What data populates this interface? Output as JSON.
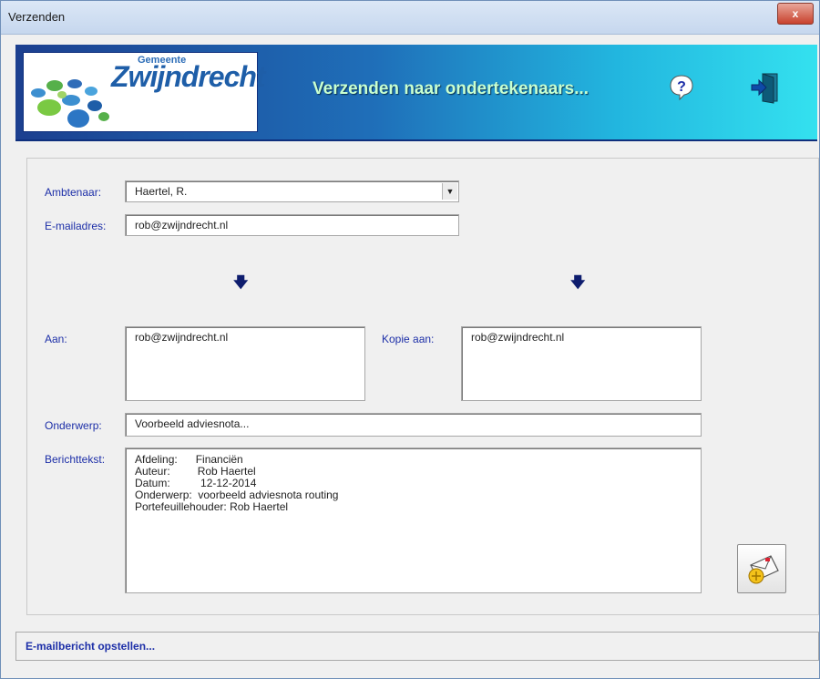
{
  "window": {
    "title": "Verzenden",
    "close_label": "x"
  },
  "banner": {
    "logo_gemeente": "Gemeente",
    "logo_name": "Zwijndrecht",
    "title": "Verzenden naar ondertekenaars...",
    "help_icon": "help-question-icon",
    "exit_icon": "exit-door-icon"
  },
  "form": {
    "ambtenaar_label": "Ambtenaar:",
    "ambtenaar_value": "Haertel, R.",
    "email_label": "E-mailadres:",
    "email_value": "rob@zwijndrecht.nl",
    "aan_label": "Aan:",
    "aan_value": "rob@zwijndrecht.nl",
    "kopie_label": "Kopie aan:",
    "kopie_value": "rob@zwijndrecht.nl",
    "onderwerp_label": "Onderwerp:",
    "onderwerp_value": "Voorbeeld adviesnota...",
    "bericht_label": "Berichttekst:",
    "bericht_value": "Afdeling:      Financiën\nAuteur:         Rob Haertel\nDatum:          12-12-2014\nOnderwerp:  voorbeeld adviesnota routing\nPortefeuillehouder: Rob Haertel"
  },
  "status": {
    "text": "E-mailbericht opstellen..."
  },
  "colors": {
    "label": "#1d2fa8",
    "banner_start": "#1c3f8f",
    "banner_end": "#34e1ef"
  }
}
